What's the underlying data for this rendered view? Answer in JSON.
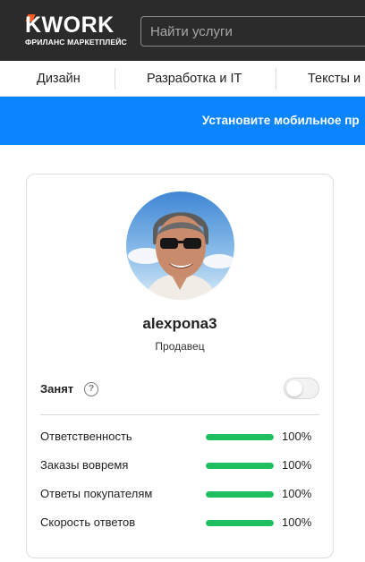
{
  "header": {
    "logo_text": "KWORK",
    "logo_subtitle": "ФРИЛАНС МАРКЕТПЛЕЙС",
    "search_placeholder": "Найти услуги"
  },
  "categories": [
    "Дизайн",
    "Разработка и IT",
    "Тексты и"
  ],
  "banner": {
    "text": "Установите мобильное пр"
  },
  "profile": {
    "username": "alexpona3",
    "role": "Продавец",
    "busy_label": "Занят",
    "busy_help_icon": "question-circle-icon",
    "busy_on": false
  },
  "metrics": [
    {
      "label": "Ответственность",
      "value_text": "100%",
      "value": 100
    },
    {
      "label": "Заказы вовремя",
      "value_text": "100%",
      "value": 100
    },
    {
      "label": "Ответы покупателям",
      "value_text": "100%",
      "value": 100
    },
    {
      "label": "Скорость ответов",
      "value_text": "100%",
      "value": 100
    }
  ],
  "colors": {
    "header_bg": "#2b2b2b",
    "logo_accent": "#ff5a1f",
    "banner_bg": "#0a84ff",
    "metric_bar": "#1fbe5f"
  }
}
